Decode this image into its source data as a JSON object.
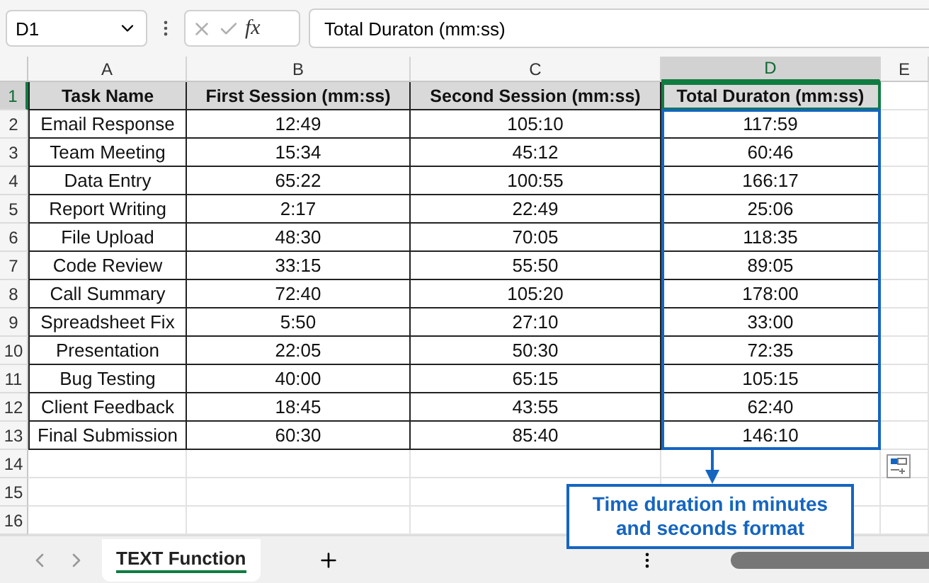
{
  "formula_bar": {
    "name_box": "D1",
    "function_label": "fx",
    "formula": "Total Duraton (mm:ss)"
  },
  "grid": {
    "columns": [
      {
        "label": "A",
        "selected": false
      },
      {
        "label": "B",
        "selected": false
      },
      {
        "label": "C",
        "selected": false
      },
      {
        "label": "D",
        "selected": true
      },
      {
        "label": "E",
        "selected": false
      }
    ],
    "header": {
      "row_number": "1",
      "selected": true,
      "cells": [
        "Task Name",
        "First Session (mm:ss)",
        "Second Session (mm:ss)",
        "Total Duraton (mm:ss)"
      ]
    },
    "rows": [
      {
        "row_number": "2",
        "selected": false,
        "cells": [
          "Email Response",
          "12:49",
          "105:10",
          "117:59"
        ]
      },
      {
        "row_number": "3",
        "selected": false,
        "cells": [
          "Team Meeting",
          "15:34",
          "45:12",
          "60:46"
        ]
      },
      {
        "row_number": "4",
        "selected": false,
        "cells": [
          "Data Entry",
          "65:22",
          "100:55",
          "166:17"
        ]
      },
      {
        "row_number": "5",
        "selected": false,
        "cells": [
          "Report Writing",
          "2:17",
          "22:49",
          "25:06"
        ]
      },
      {
        "row_number": "6",
        "selected": false,
        "cells": [
          "File Upload",
          "48:30",
          "70:05",
          "118:35"
        ]
      },
      {
        "row_number": "7",
        "selected": false,
        "cells": [
          "Code Review",
          "33:15",
          "55:50",
          "89:05"
        ]
      },
      {
        "row_number": "8",
        "selected": false,
        "cells": [
          "Call Summary",
          "72:40",
          "105:20",
          "178:00"
        ]
      },
      {
        "row_number": "9",
        "selected": false,
        "cells": [
          "Spreadsheet Fix",
          "5:50",
          "27:10",
          "33:00"
        ]
      },
      {
        "row_number": "10",
        "selected": false,
        "cells": [
          "Presentation",
          "22:05",
          "50:30",
          "72:35"
        ]
      },
      {
        "row_number": "11",
        "selected": false,
        "cells": [
          "Bug Testing",
          "40:00",
          "65:15",
          "105:15"
        ]
      },
      {
        "row_number": "12",
        "selected": false,
        "cells": [
          "Client Feedback",
          "18:45",
          "43:55",
          "62:40"
        ]
      },
      {
        "row_number": "13",
        "selected": false,
        "cells": [
          "Final Submission",
          "60:30",
          "85:40",
          "146:10"
        ]
      }
    ],
    "empty_rows": [
      "14",
      "15",
      "16"
    ]
  },
  "callout": "Time duration in minutes and seconds format",
  "sheet_tabs": [
    {
      "label": "TEXT Function",
      "selected": true
    }
  ]
}
